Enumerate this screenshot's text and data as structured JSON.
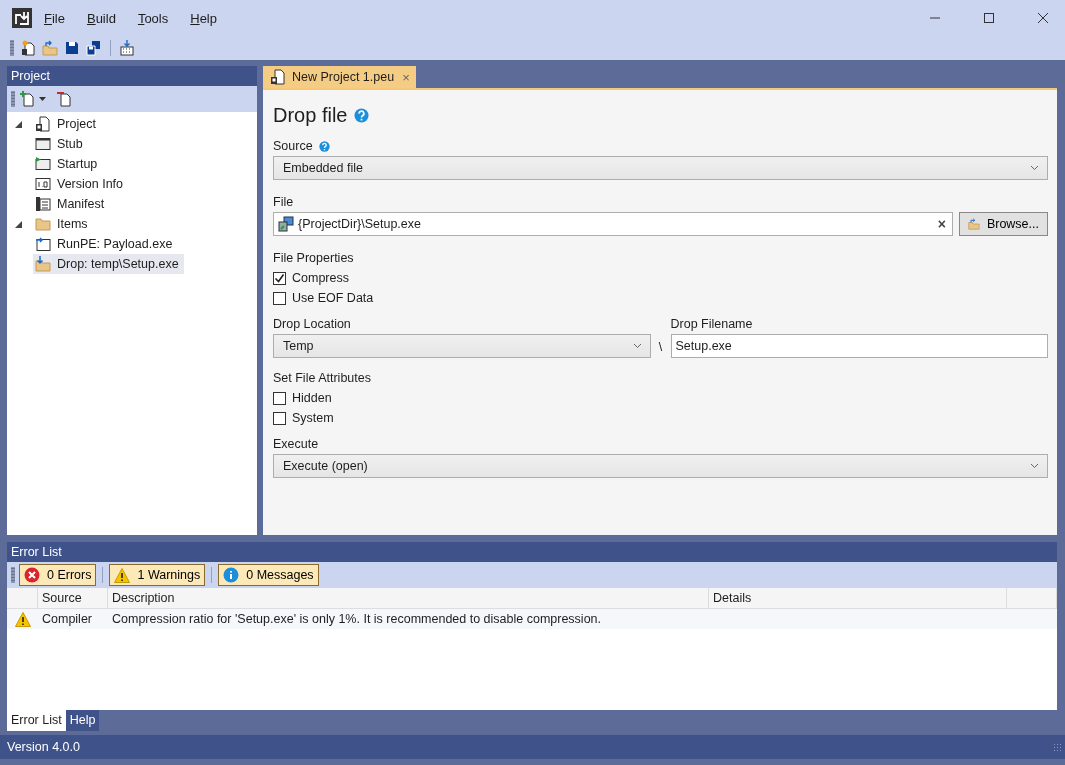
{
  "menu": [
    {
      "label": "File"
    },
    {
      "label": "Build"
    },
    {
      "label": "Tools"
    },
    {
      "label": "Help"
    }
  ],
  "project_panel": {
    "title": "Project",
    "tree": [
      {
        "label": "Project",
        "kind": "project",
        "expanded": true,
        "selected": false,
        "children": [
          {
            "label": "Stub",
            "kind": "stub",
            "selected": false
          },
          {
            "label": "Startup",
            "kind": "startup",
            "selected": false
          },
          {
            "label": "Version Info",
            "kind": "version",
            "selected": false
          },
          {
            "label": "Manifest",
            "kind": "manifest",
            "selected": false
          }
        ]
      },
      {
        "label": "Items",
        "kind": "folder",
        "expanded": true,
        "selected": false,
        "children": [
          {
            "label": "RunPE: Payload.exe",
            "kind": "runpe",
            "selected": false
          },
          {
            "label": "Drop: temp\\Setup.exe",
            "kind": "drop",
            "selected": true
          }
        ]
      }
    ]
  },
  "document_tab": {
    "label": "New Project 1.peu",
    "close": "×"
  },
  "editor": {
    "title": "Drop file",
    "source": {
      "label": "Source",
      "value": "Embedded file"
    },
    "file": {
      "label": "File",
      "value": "{ProjectDir}\\Setup.exe",
      "clear": "×",
      "browse": "Browse..."
    },
    "file_properties": {
      "label": "File Properties",
      "options": [
        {
          "label": "Compress",
          "checked": true
        },
        {
          "label": "Use EOF Data",
          "checked": false
        }
      ]
    },
    "drop_location": {
      "label": "Drop Location",
      "value": "Temp"
    },
    "separator": "\\",
    "drop_filename": {
      "label": "Drop Filename",
      "value": "Setup.exe"
    },
    "attributes": {
      "label": "Set File Attributes",
      "options": [
        {
          "label": "Hidden",
          "checked": false
        },
        {
          "label": "System",
          "checked": false
        }
      ]
    },
    "execute": {
      "label": "Execute",
      "value": "Execute (open)"
    }
  },
  "error_list": {
    "title": "Error List",
    "filters": [
      {
        "kind": "error",
        "label": "0 Errors",
        "on": true
      },
      {
        "kind": "warning",
        "label": "1 Warnings",
        "on": true
      },
      {
        "kind": "message",
        "label": "0 Messages",
        "on": true
      }
    ],
    "columns": [
      "Source",
      "Description",
      "Details"
    ],
    "rows": [
      {
        "kind": "warning",
        "source": "Compiler",
        "description": "Compression ratio for 'Setup.exe' is only 1%. It is recommended to disable compression.",
        "details": ""
      }
    ]
  },
  "bottom_tabs": [
    {
      "label": "Error List",
      "selected": true
    },
    {
      "label": "Help",
      "selected": false
    }
  ],
  "status_bar": {
    "version": "Version 4.0.0"
  }
}
